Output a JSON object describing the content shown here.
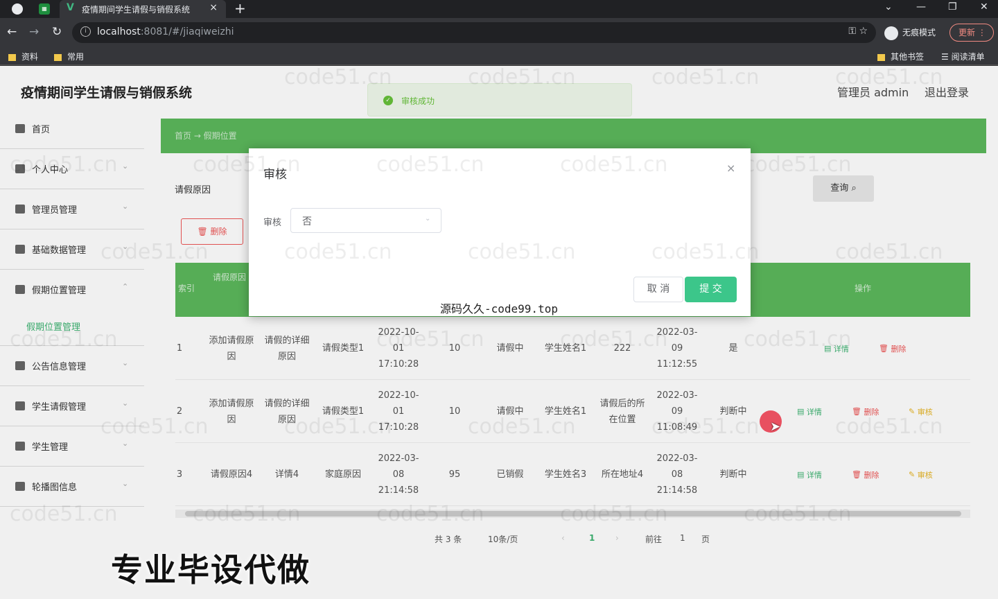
{
  "browser": {
    "tab_title": "疫情期间学生请假与销假系统",
    "url_host": "localhost",
    "url_rest": ":8081/#/jiaqiweizhi",
    "incognito_label": "无痕模式",
    "update_label": "更新",
    "bookmarks": [
      "资料",
      "常用"
    ],
    "other_bookmarks": "其他书签",
    "reading_list": "阅读清单"
  },
  "header": {
    "title": "疫情期间学生请假与销假系统",
    "admin": "管理员 admin",
    "logout": "退出登录"
  },
  "sidebar": {
    "items": [
      "首页",
      "个人中心",
      "管理员管理",
      "基础数据管理",
      "假期位置管理"
    ],
    "active_sub": "假期位置管理",
    "items2": [
      "公告信息管理",
      "学生请假管理",
      "学生管理",
      "轮播图信息"
    ]
  },
  "breadcrumb": "首页 → 假期位置",
  "search": {
    "label": "请假原因",
    "button": "查询"
  },
  "toolbar": {
    "delete": "删除"
  },
  "table": {
    "headers": [
      "索引",
      "请假原因",
      "操作"
    ],
    "rows": [
      {
        "idx": "1",
        "c1": "添加请假原因",
        "c2": "请假的详细原因",
        "c3": "请假类型1",
        "c4": "2022-10-01 17:10:28",
        "c5": "10",
        "c6": "请假中",
        "c7": "学生姓名1",
        "c8": "222",
        "c9": "2022-03-09 11:12:55",
        "c10": "是",
        "detail": "详情",
        "del": "删除",
        "audit": ""
      },
      {
        "idx": "2",
        "c1": "添加请假原因",
        "c2": "请假的详细原因",
        "c3": "请假类型1",
        "c4": "2022-10-01 17:10:28",
        "c5": "10",
        "c6": "请假中",
        "c7": "学生姓名1",
        "c8": "请假后的所在位置",
        "c9": "2022-03-09 11:08:49",
        "c10": "判断中",
        "detail": "详情",
        "del": "删除",
        "audit": "审核"
      },
      {
        "idx": "3",
        "c1": "请假原因4",
        "c2": "详情4",
        "c3": "家庭原因",
        "c4": "2022-03-08 21:14:58",
        "c5": "95",
        "c6": "已销假",
        "c7": "学生姓名3",
        "c8": "所在地址4",
        "c9": "2022-03-08 21:14:58",
        "c10": "判断中",
        "detail": "详情",
        "del": "删除",
        "audit": "审核"
      }
    ]
  },
  "pager": {
    "total": "共 3 条",
    "size": "10条/页",
    "current": "1",
    "goto": "前往",
    "goto_val": "1",
    "page": "页"
  },
  "toast": "审核成功",
  "dialog": {
    "title": "审核",
    "label": "审核",
    "value": "否",
    "cancel": "取 消",
    "submit": "提 交",
    "footer": "源码久久-code99.top"
  },
  "watermark": "code51.cn",
  "overlay_text": "专业毕设代做"
}
